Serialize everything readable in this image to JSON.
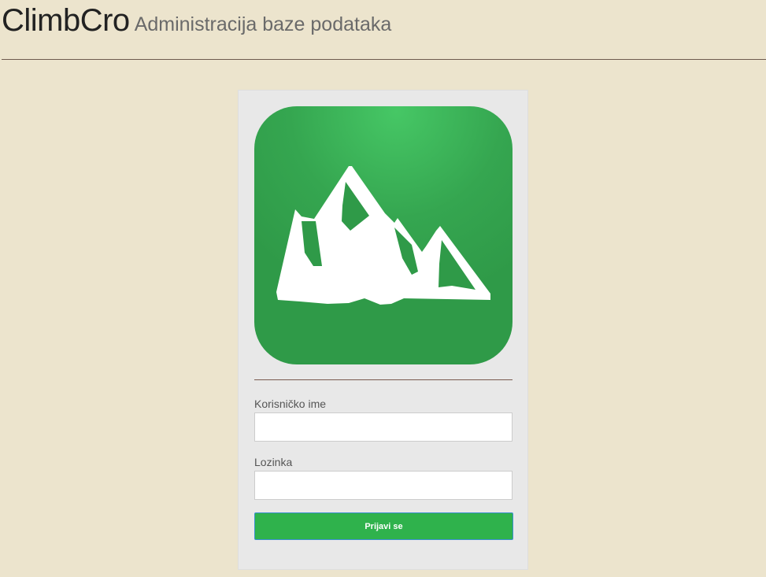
{
  "header": {
    "brand": "ClimbCro",
    "subtitle": "Administracija baze podataka"
  },
  "logo": {
    "icon": "mountain-icon",
    "colors": {
      "background_light": "#46c765",
      "background_dark": "#2f9a48",
      "mountain": "#ffffff"
    }
  },
  "login": {
    "username_label": "Korisničko ime",
    "username_value": "",
    "password_label": "Lozinka",
    "password_value": "",
    "submit_label": "Prijavi se"
  },
  "colors": {
    "page_background": "#ece4cd",
    "panel_background": "#e8e8e8",
    "button": "#2fb24c",
    "divider": "#6e5a4e"
  }
}
